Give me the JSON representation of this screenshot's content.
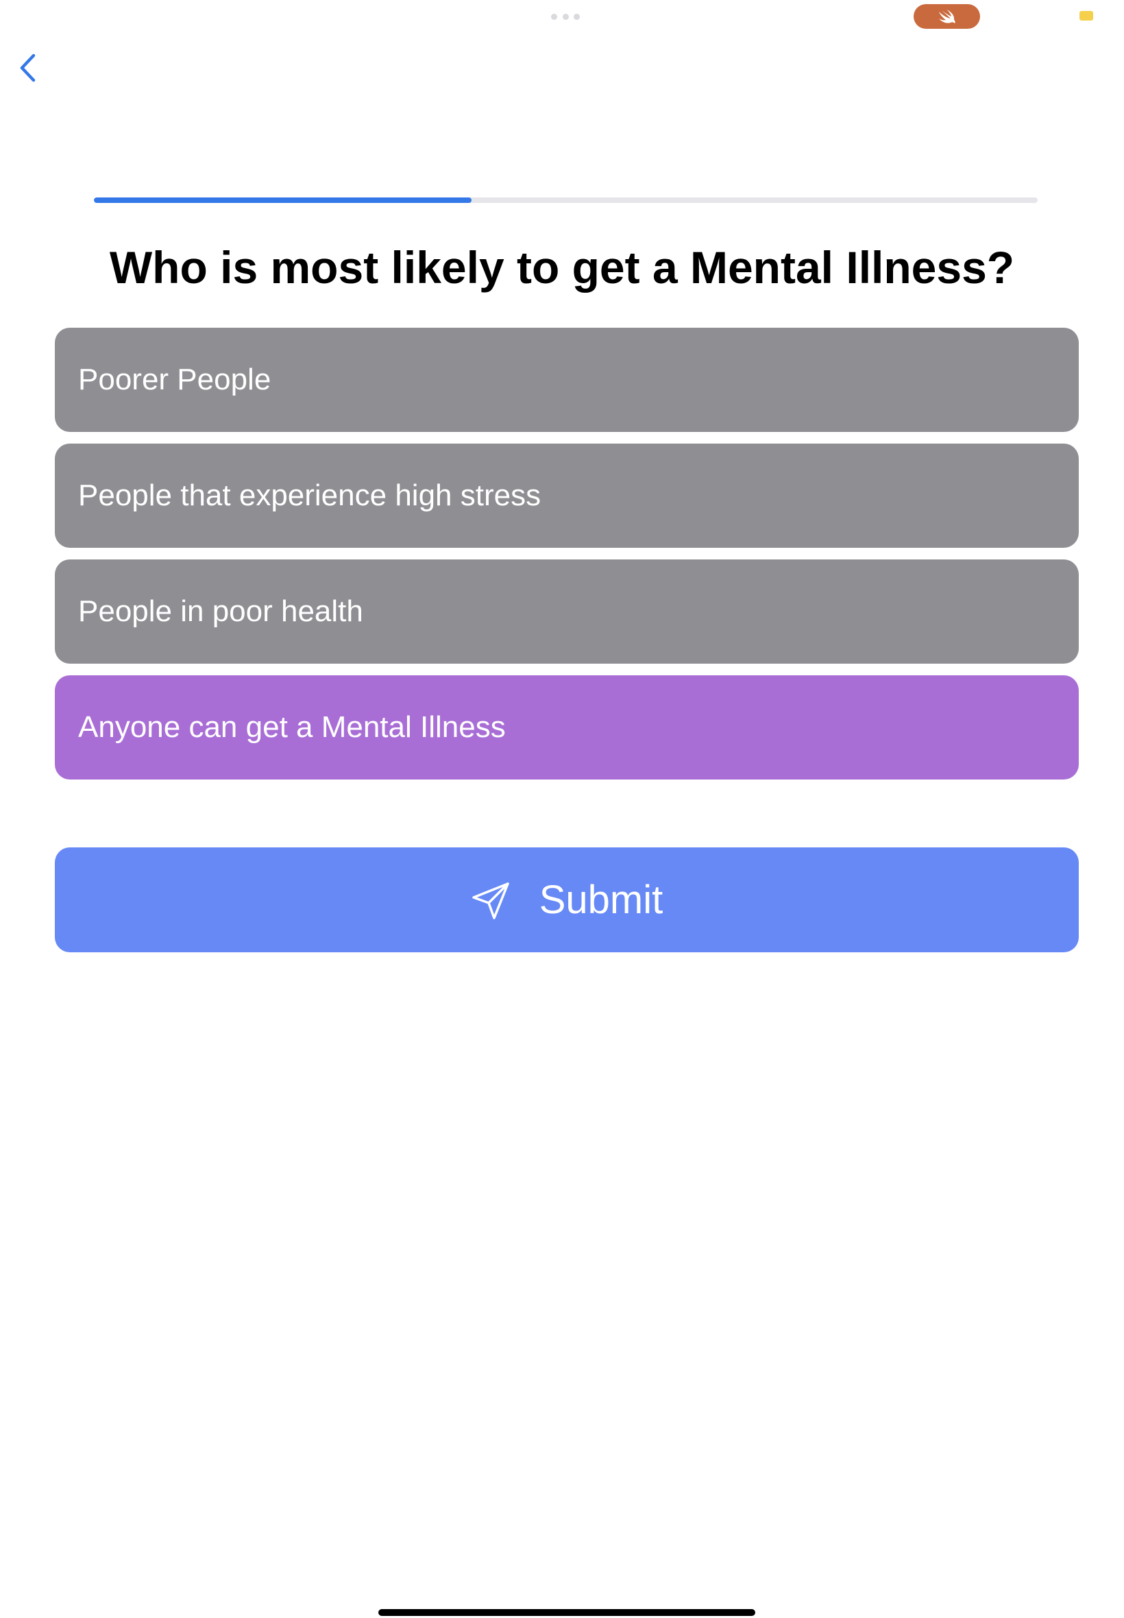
{
  "status_bar": {
    "pill_color": "#c96a3e",
    "pill_icon": "swift-icon",
    "indicator_color": "#f5d04c"
  },
  "nav": {
    "back_icon": "chevron-left-icon",
    "accent": "#3478e8"
  },
  "quiz": {
    "progress": 0.4,
    "question": "Who is most likely to get a Mental Illness?",
    "answers": [
      {
        "label": "Poorer People",
        "selected": false
      },
      {
        "label": "People that experience high stress",
        "selected": false
      },
      {
        "label": "People in poor health",
        "selected": false
      },
      {
        "label": "Anyone can get a Mental Illness",
        "selected": true
      }
    ],
    "answer_color": "#8e8e93",
    "selected_color": "#a96ed6"
  },
  "submit": {
    "label": "Submit",
    "icon": "paper-plane-icon",
    "color": "#6689f6"
  }
}
